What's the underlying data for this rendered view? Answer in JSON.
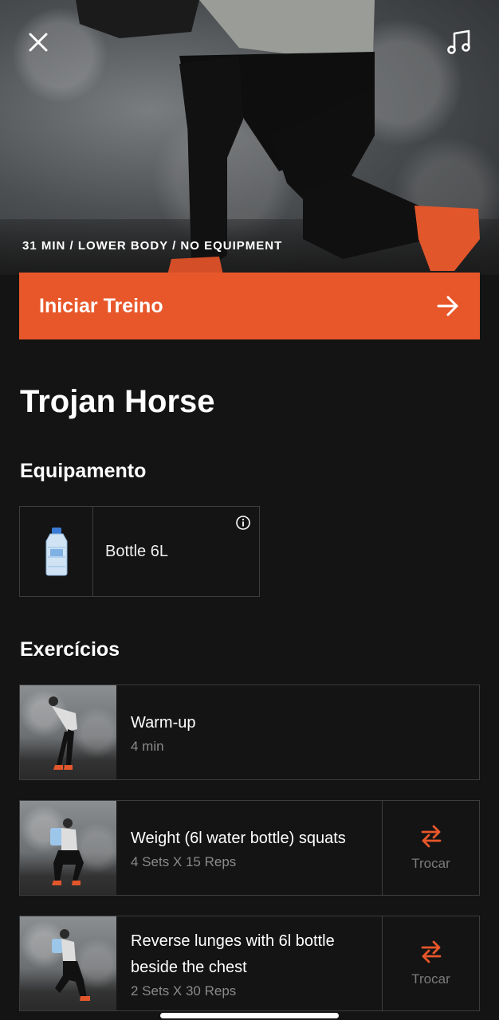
{
  "hero": {
    "meta": "31 MIN / LOWER BODY / NO EQUIPMENT"
  },
  "start_button": {
    "label": "Iniciar Treino"
  },
  "workout": {
    "title": "Trojan Horse"
  },
  "equipment": {
    "heading": "Equipamento",
    "items": [
      {
        "label": "Bottle 6L",
        "icon": "water-bottle-icon"
      }
    ]
  },
  "exercises": {
    "heading": "Exercícios",
    "items": [
      {
        "name": "Warm-up",
        "meta": "4 min"
      },
      {
        "name": "Weight (6l water bottle) squats",
        "meta": "4 Sets X  15 Reps",
        "swap_label": "Trocar"
      },
      {
        "name": "Reverse lunges with 6l bottle beside the chest",
        "meta": "2 Sets X  30 Reps",
        "swap_label": "Trocar"
      }
    ]
  },
  "colors": {
    "accent": "#e8572a",
    "background": "#141414",
    "border": "#3d3d3d",
    "muted": "#8a8a8a"
  }
}
